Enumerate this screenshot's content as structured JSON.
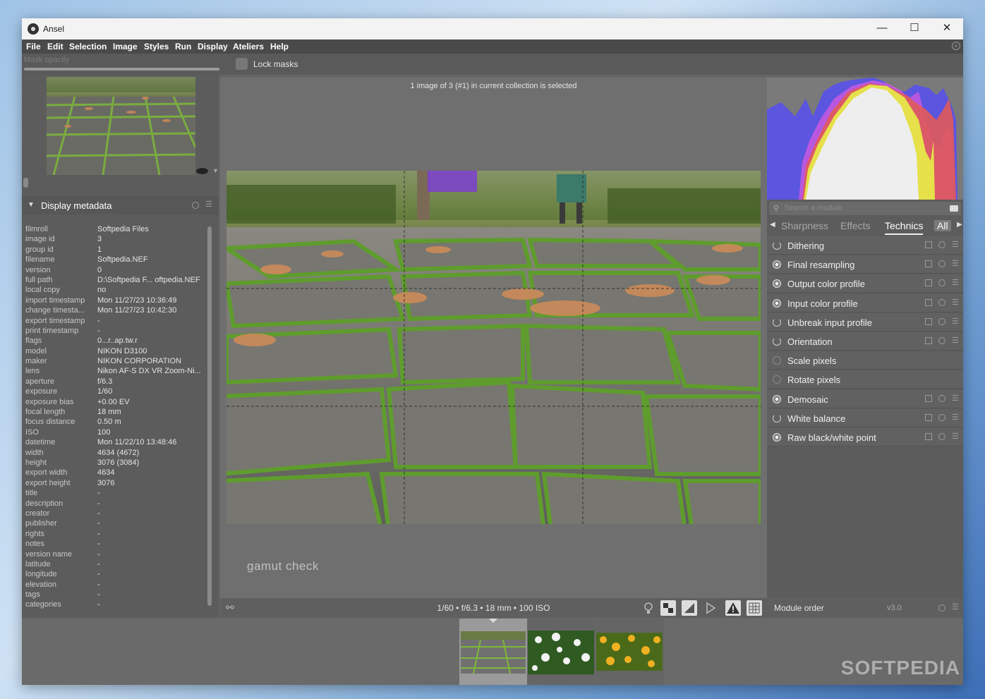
{
  "window": {
    "title": "Ansel",
    "minimize": "—",
    "maximize": "☐",
    "close": "✕"
  },
  "menu": [
    "File",
    "Edit",
    "Selection",
    "Image",
    "Styles",
    "Run",
    "Display",
    "Ateliers",
    "Help"
  ],
  "toolbar": {
    "mask_opacity_label": "Mask opacity",
    "lock_masks_label": "Lock masks"
  },
  "center": {
    "collection_info": "1 image of 3 (#1) in current collection is selected",
    "overlay_label": "gamut check",
    "exif_summary": "1/60 • f/6.3 • 18 mm • 100 ISO"
  },
  "metadata_panel": {
    "title": "Display metadata",
    "rows": [
      {
        "key": "filmroll",
        "value": "Softpedia Files"
      },
      {
        "key": "image id",
        "value": "3"
      },
      {
        "key": "group id",
        "value": "1"
      },
      {
        "key": "filename",
        "value": "Softpedia.NEF"
      },
      {
        "key": "version",
        "value": "0"
      },
      {
        "key": "full path",
        "value": "D:\\Softpedia F... oftpedia.NEF"
      },
      {
        "key": "local copy",
        "value": "no"
      },
      {
        "key": "import timestamp",
        "value": "Mon 11/27/23 10:36:49"
      },
      {
        "key": "change timesta...",
        "value": "Mon 11/27/23 10:42:30"
      },
      {
        "key": "export timestamp",
        "value": "-"
      },
      {
        "key": "print timestamp",
        "value": "-"
      },
      {
        "key": "flags",
        "value": "0...r..ap.tw.r"
      },
      {
        "key": "model",
        "value": "NIKON D3100"
      },
      {
        "key": "maker",
        "value": "NIKON CORPORATION"
      },
      {
        "key": "lens",
        "value": "Nikon AF-S DX VR Zoom-Ni..."
      },
      {
        "key": "aperture",
        "value": "f/6.3"
      },
      {
        "key": "exposure",
        "value": "1/60"
      },
      {
        "key": "exposure bias",
        "value": "+0.00 EV"
      },
      {
        "key": "focal length",
        "value": "18 mm"
      },
      {
        "key": "focus distance",
        "value": "0.50 m"
      },
      {
        "key": "ISO",
        "value": "100"
      },
      {
        "key": "datetime",
        "value": "Mon 11/22/10 13:48:46"
      },
      {
        "key": "width",
        "value": "4634 (4672)"
      },
      {
        "key": "height",
        "value": "3076 (3084)"
      },
      {
        "key": "export width",
        "value": "4634"
      },
      {
        "key": "export height",
        "value": "3076"
      },
      {
        "key": "title",
        "value": "-"
      },
      {
        "key": "description",
        "value": "-"
      },
      {
        "key": "creator",
        "value": "-"
      },
      {
        "key": "publisher",
        "value": "-"
      },
      {
        "key": "rights",
        "value": "-"
      },
      {
        "key": "notes",
        "value": "-"
      },
      {
        "key": "version name",
        "value": "-"
      },
      {
        "key": "latitude",
        "value": "-"
      },
      {
        "key": "longitude",
        "value": "-"
      },
      {
        "key": "elevation",
        "value": "-"
      },
      {
        "key": "tags",
        "value": "-"
      },
      {
        "key": "categories",
        "value": "-"
      }
    ]
  },
  "right_panel": {
    "search_placeholder": "Search a module",
    "tabs": [
      "Sharpness",
      "Effects",
      "Technics",
      "All"
    ],
    "active_tab": "Technics",
    "modules": [
      {
        "name": "Dithering",
        "state": "power"
      },
      {
        "name": "Final resampling",
        "state": "on"
      },
      {
        "name": "Output color profile",
        "state": "on"
      },
      {
        "name": "Input color profile",
        "state": "on"
      },
      {
        "name": "Unbreak input profile",
        "state": "power"
      },
      {
        "name": "Orientation",
        "state": "power"
      },
      {
        "name": "Scale pixels",
        "state": "off"
      },
      {
        "name": "Rotate pixels",
        "state": "off"
      },
      {
        "name": "Demosaic",
        "state": "on"
      },
      {
        "name": "White balance",
        "state": "power"
      },
      {
        "name": "Raw black/white point",
        "state": "on"
      }
    ],
    "module_order_label": "Module order",
    "module_order_version": "v3.0"
  },
  "filmstrip": {
    "count": 3,
    "selected_index": 0
  },
  "watermark": "SOFTPEDIA",
  "colors": {
    "panel_bg": "#5c5c5c",
    "center_bg": "#6f6f6f",
    "menubar_bg": "#4a4a4a",
    "hist_blue": "#5b55e0",
    "hist_red": "#e05a5a",
    "hist_yellow": "#e6e04a",
    "hist_magenta": "#e05ae0"
  },
  "icons": {
    "search": "magnifier-icon",
    "clear": "backspace-icon",
    "bottom_tools": [
      "bulb-icon",
      "checker-icon",
      "softproof-icon",
      "focus-peaking-icon",
      "gamut-warning-icon",
      "guides-grid-icon"
    ]
  }
}
